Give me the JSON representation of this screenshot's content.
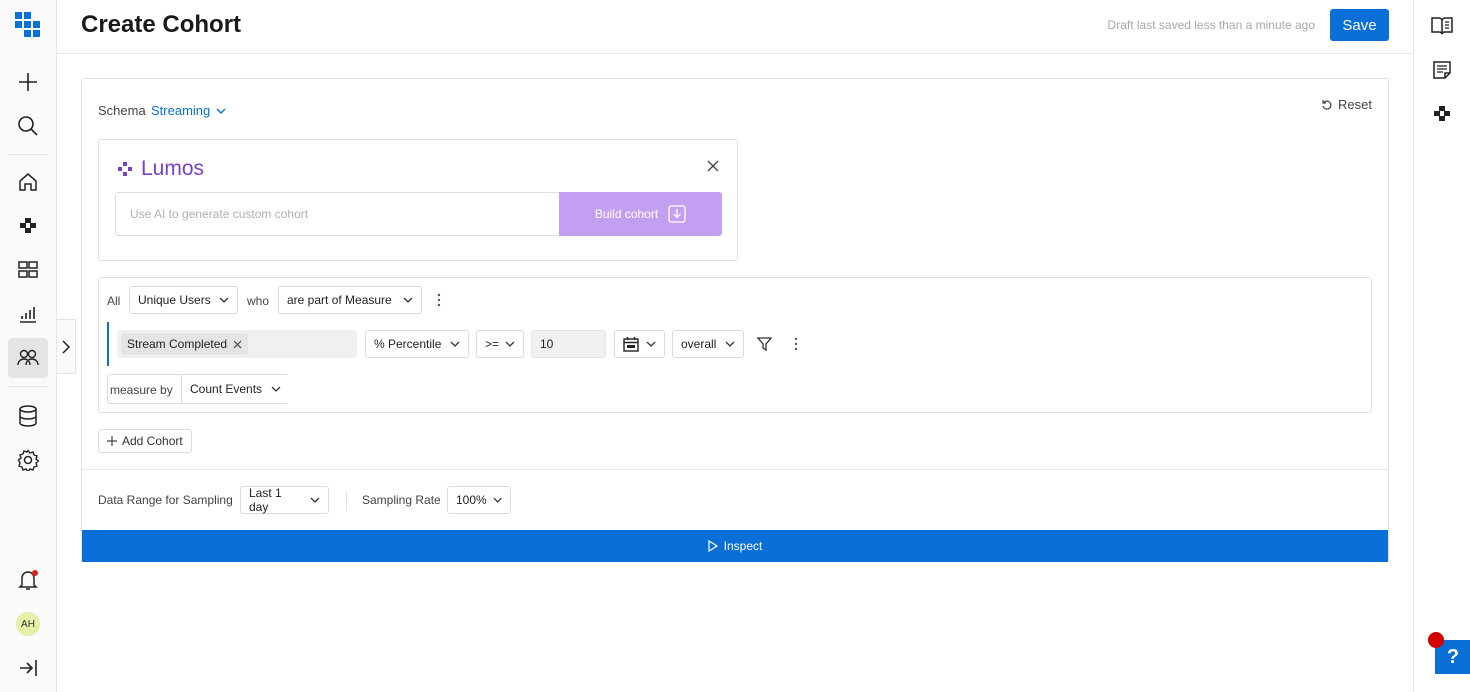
{
  "header": {
    "title": "Create Cohort",
    "draft_status": "Draft last saved less than a minute ago",
    "save_label": "Save"
  },
  "left_nav": {
    "items": [
      "logo-icon",
      "plus-icon",
      "search-icon",
      "home-icon",
      "explore-icon",
      "dashboard-icon",
      "chart-icon",
      "cohorts-icon",
      "database-icon",
      "settings-icon",
      "bell-icon",
      "avatar",
      "collapse-icon"
    ],
    "active": "cohorts-icon",
    "avatar_initials": "AH"
  },
  "right_nav": {
    "items": [
      "book-icon",
      "notes-icon",
      "explore-icon"
    ],
    "help_label": "?"
  },
  "schema": {
    "label": "Schema",
    "value": "Streaming"
  },
  "reset_label": "Reset",
  "lumos": {
    "name": "Lumos",
    "input_placeholder": "Use AI to generate custom cohort",
    "build_label": "Build cohort"
  },
  "rule": {
    "prefix": "All",
    "subject": "Unique Users",
    "who_label": "who",
    "condition": "are part of Measure",
    "event_chip": "Stream Completed",
    "metric": "% Percentile",
    "operator": ">=",
    "threshold": "10",
    "scope": "overall",
    "measure_by_label": "measure by",
    "measure_by": "Count Events"
  },
  "add_cohort_label": "Add Cohort",
  "sampling": {
    "range_label": "Data Range for Sampling",
    "range_value": "Last 1 day",
    "rate_label": "Sampling Rate",
    "rate_value": "100%"
  },
  "inspect_label": "Inspect",
  "colors": {
    "primary": "#0a6fd6",
    "lumos_purple": "#7a3fc9",
    "build_button": "#c29ff0"
  }
}
